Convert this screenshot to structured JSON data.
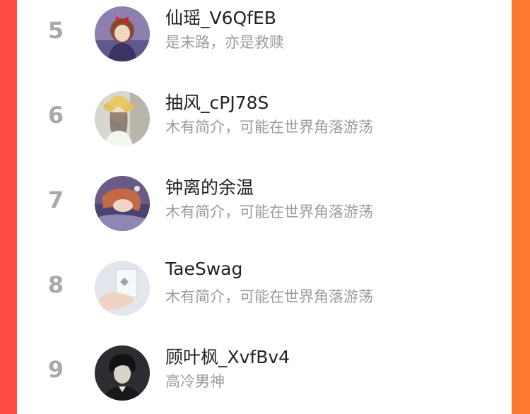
{
  "colors": {
    "background_gradient_start": "#ff4b45",
    "background_gradient_end": "#ff7a30",
    "panel": "#ffffff",
    "rank": "#a9a9a9",
    "name": "#222222",
    "bio": "#9b9b9b"
  },
  "ranking": {
    "items": [
      {
        "rank": "5",
        "name": "仙瑶_V6QfEB",
        "bio": "是末路，亦是救赎",
        "avatar": "anime-girl-red-bow-avatar"
      },
      {
        "rank": "6",
        "name": "抽风_cPJ78S",
        "bio": "木有简介，可能在世界角落游荡",
        "avatar": "girl-yellow-hat-avatar"
      },
      {
        "rank": "7",
        "name": "钟离的余温",
        "bio": "木有简介，可能在世界角落游荡",
        "avatar": "anime-girl-sleeping-avatar"
      },
      {
        "rank": "8",
        "name": "TaeSwag",
        "bio": "木有简介，可能在世界角落游荡",
        "avatar": "hand-holding-card-avatar"
      },
      {
        "rank": "9",
        "name": "顾叶枫_XvfBv4",
        "bio": "高冷男神",
        "avatar": "anime-boy-dark-hair-avatar"
      }
    ]
  }
}
